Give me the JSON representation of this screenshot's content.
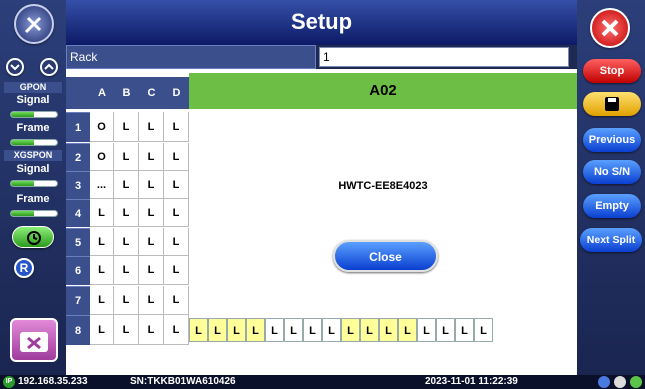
{
  "header": {
    "title": "Setup"
  },
  "rack": {
    "label": "Rack",
    "value": "1"
  },
  "left": {
    "gpon": "GPON",
    "signal": "Signal",
    "frame": "Frame",
    "xgspon": "XGSPON",
    "signal2": "Signal",
    "frame2": "Frame",
    "r_badge": "R"
  },
  "right": {
    "stop": "Stop",
    "previous": "Previous",
    "no_sn": "No S/N",
    "empty": "Empty",
    "next_split": "Next Split"
  },
  "grid": {
    "columns": [
      "A",
      "B",
      "C",
      "D"
    ],
    "rows": [
      {
        "n": "1",
        "cells": [
          "O",
          "L",
          "L",
          "L"
        ]
      },
      {
        "n": "2",
        "cells": [
          "O",
          "L",
          "L",
          "L"
        ]
      },
      {
        "n": "3",
        "cells": [
          "...",
          "L",
          "L",
          "L"
        ]
      },
      {
        "n": "4",
        "cells": [
          "L",
          "L",
          "L",
          "L"
        ]
      },
      {
        "n": "5",
        "cells": [
          "L",
          "L",
          "L",
          "L"
        ]
      },
      {
        "n": "6",
        "cells": [
          "L",
          "L",
          "L",
          "L"
        ]
      },
      {
        "n": "7",
        "cells": [
          "L",
          "L",
          "L",
          "L"
        ]
      },
      {
        "n": "8",
        "cells": [
          "L",
          "L",
          "L",
          "L"
        ]
      }
    ],
    "row8_extra": [
      "L",
      "L",
      "L",
      "L",
      "L",
      "L",
      "L",
      "L",
      "L",
      "L",
      "L",
      "L",
      "L",
      "L",
      "L",
      "L"
    ]
  },
  "popup": {
    "header": "A02",
    "serial": "HWTC-EE8E4023",
    "close": "Close"
  },
  "status": {
    "ip": "192.168.35.233",
    "sn": "SN:TKKB01WA610426",
    "datetime": "2023-11-01 11:22:39"
  },
  "colors": {
    "accent_green": "#66bb44",
    "popup_header": "#6cbf44",
    "yellow_cell": "#ffff99"
  }
}
